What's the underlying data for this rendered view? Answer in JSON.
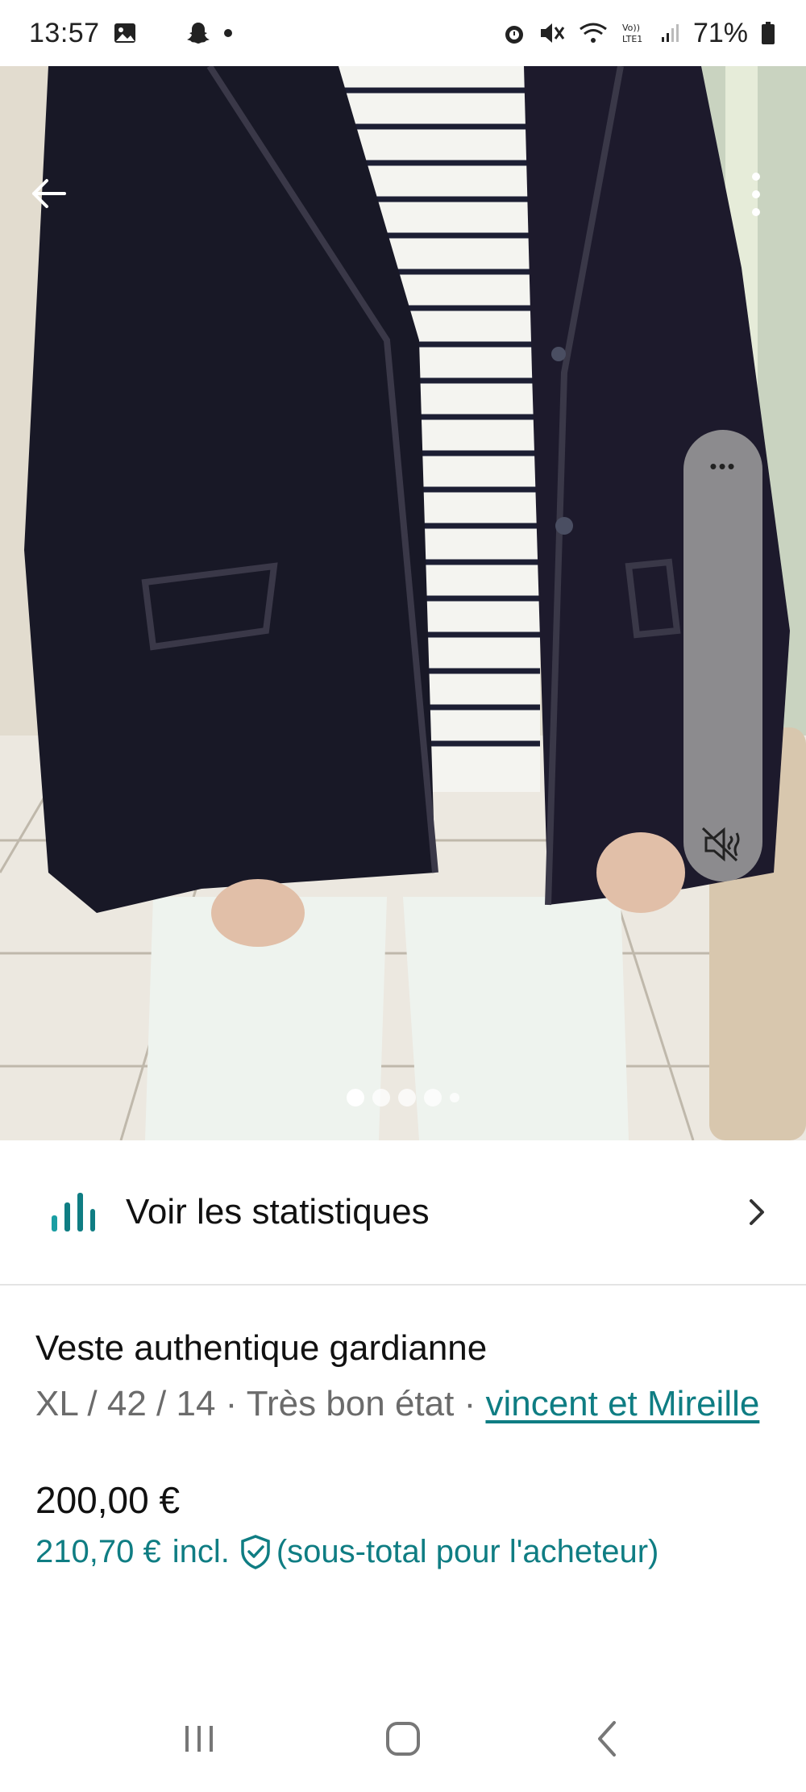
{
  "status_bar": {
    "time": "13:57",
    "battery_percent": "71%",
    "icons": [
      "gallery-icon",
      "snapchat-icon",
      "notification-dot",
      "alarm-icon",
      "mute-icon",
      "wifi-icon",
      "volte-icon",
      "signal-icon",
      "battery-icon"
    ]
  },
  "photo": {
    "description_icons": [
      "back-arrow-icon",
      "more-vertical-icon",
      "side-panel-more-icon",
      "sound-off-icon"
    ],
    "side_panel_dots": "•••",
    "pager": {
      "count": 5,
      "active_index": 0
    }
  },
  "stats": {
    "label": "Voir les statistiques",
    "icon": "bar-chart-icon"
  },
  "listing": {
    "title": "Veste authentique gardianne",
    "meta_prefix": "XL / 42 / 14 · Très bon état · ",
    "brand": "vincent et Mireille",
    "price": "200,00 €",
    "buyer_price": "210,70 €",
    "buyer_incl": "incl.",
    "buyer_note": "(sous-total pour l'acheteur)"
  },
  "colors": {
    "accent": "#0f7d83",
    "text": "#111111",
    "muted": "#6b6b6b"
  },
  "nav_bar": {
    "buttons": [
      "recent-apps-icon",
      "home-icon",
      "back-icon"
    ]
  }
}
